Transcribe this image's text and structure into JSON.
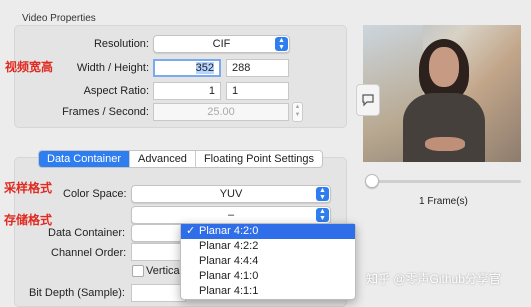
{
  "video_properties": {
    "title": "Video Properties",
    "resolution": {
      "label": "Resolution:",
      "value": "CIF"
    },
    "width_height": {
      "label": "Width / Height:",
      "width": "352",
      "height": "288"
    },
    "aspect_ratio": {
      "label": "Aspect Ratio:",
      "a": "1",
      "b": "1"
    },
    "fps": {
      "label": "Frames / Second:",
      "value": "25.00"
    }
  },
  "tabs": [
    "Data Container",
    "Advanced",
    "Floating Point Settings"
  ],
  "format": {
    "color_space": {
      "label": "Color Space:",
      "value": "YUV"
    },
    "subsampling": {
      "value": "–"
    },
    "data_container": {
      "label": "Data Container:"
    },
    "channel_order": {
      "label": "Channel Order:"
    },
    "vertical": {
      "label": "Vertical"
    },
    "bit_depth": {
      "label": "Bit Depth (Sample):"
    }
  },
  "annotations": {
    "size": "视频宽高",
    "sampling": "采样格式",
    "storage": "存储格式"
  },
  "preview": {
    "frames": "1 Frame(s)",
    "slider_position": 0
  },
  "dropdown": {
    "options": [
      "Planar 4:2:0",
      "Planar 4:2:2",
      "Planar 4:4:4",
      "Planar 4:1:0",
      "Planar 4:1:1"
    ],
    "selected": 0
  },
  "watermark": "知乎 @零声Github分享官",
  "colors": {
    "accent": "#2f7ef0",
    "annotation": "#e0291f"
  }
}
